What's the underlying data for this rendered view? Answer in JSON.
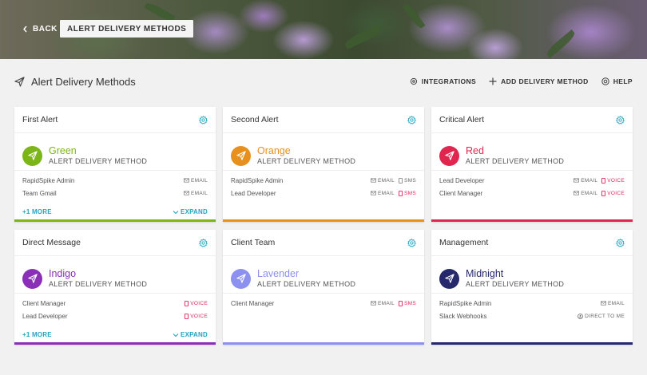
{
  "hero": {
    "back_label": "BACK",
    "current_label": "ALERT DELIVERY METHODS"
  },
  "header": {
    "title": "Alert Delivery Methods",
    "actions": {
      "integrations": "INTEGRATIONS",
      "add": "ADD DELIVERY METHOD",
      "help": "HELP"
    }
  },
  "method_sub": "ALERT DELIVERY METHOD",
  "colors": {
    "accent": "#27a3c2",
    "sms_voice": "#e2245e",
    "green": "#7cb518",
    "orange": "#e8901d",
    "red": "#e0264f",
    "indigo": "#8a2fb8",
    "lavender": "#8c90ee",
    "midnight": "#25286b"
  },
  "cards": [
    {
      "title": "First Alert",
      "name": "Green",
      "color": "#7cb518",
      "rows": [
        {
          "name": "RapidSpike Admin",
          "tags": [
            {
              "type": "email",
              "label": "EMAIL"
            }
          ]
        },
        {
          "name": "Team Gmail",
          "tags": [
            {
              "type": "email",
              "label": "EMAIL"
            }
          ]
        }
      ],
      "more": "+1 MORE",
      "expand": "EXPAND"
    },
    {
      "title": "Second Alert",
      "name": "Orange",
      "color": "#e8901d",
      "rows": [
        {
          "name": "RapidSpike Admin",
          "tags": [
            {
              "type": "email",
              "label": "EMAIL"
            },
            {
              "type": "sms-plain",
              "label": "SMS"
            }
          ]
        },
        {
          "name": "Lead Developer",
          "tags": [
            {
              "type": "email",
              "label": "EMAIL"
            },
            {
              "type": "sms",
              "label": "SMS"
            }
          ]
        }
      ],
      "more": "",
      "expand": ""
    },
    {
      "title": "Critical Alert",
      "name": "Red",
      "color": "#e0264f",
      "rows": [
        {
          "name": "Lead Developer",
          "tags": [
            {
              "type": "email",
              "label": "EMAIL"
            },
            {
              "type": "voice",
              "label": "VOICE"
            }
          ]
        },
        {
          "name": "Client Manager",
          "tags": [
            {
              "type": "email",
              "label": "EMAIL"
            },
            {
              "type": "voice",
              "label": "VOICE"
            }
          ]
        }
      ],
      "more": "",
      "expand": ""
    },
    {
      "title": "Direct Message",
      "name": "Indigo",
      "color": "#8a2fb8",
      "rows": [
        {
          "name": "Client Manager",
          "tags": [
            {
              "type": "voice",
              "label": "VOICE"
            }
          ]
        },
        {
          "name": "Lead Developer",
          "tags": [
            {
              "type": "voice",
              "label": "VOICE"
            }
          ]
        }
      ],
      "more": "+1 MORE",
      "expand": "EXPAND"
    },
    {
      "title": "Client Team",
      "name": "Lavender",
      "color": "#8c90ee",
      "rows": [
        {
          "name": "Client Manager",
          "tags": [
            {
              "type": "email",
              "label": "EMAIL"
            },
            {
              "type": "sms",
              "label": "SMS"
            }
          ]
        }
      ],
      "more": "",
      "expand": ""
    },
    {
      "title": "Management",
      "name": "Midnight",
      "color": "#25286b",
      "rows": [
        {
          "name": "RapidSpike Admin",
          "tags": [
            {
              "type": "email",
              "label": "EMAIL"
            }
          ]
        },
        {
          "name": "Slack Webhooks",
          "tags": [
            {
              "type": "direct",
              "label": "DIRECT TO ME"
            }
          ]
        }
      ],
      "more": "",
      "expand": ""
    }
  ]
}
